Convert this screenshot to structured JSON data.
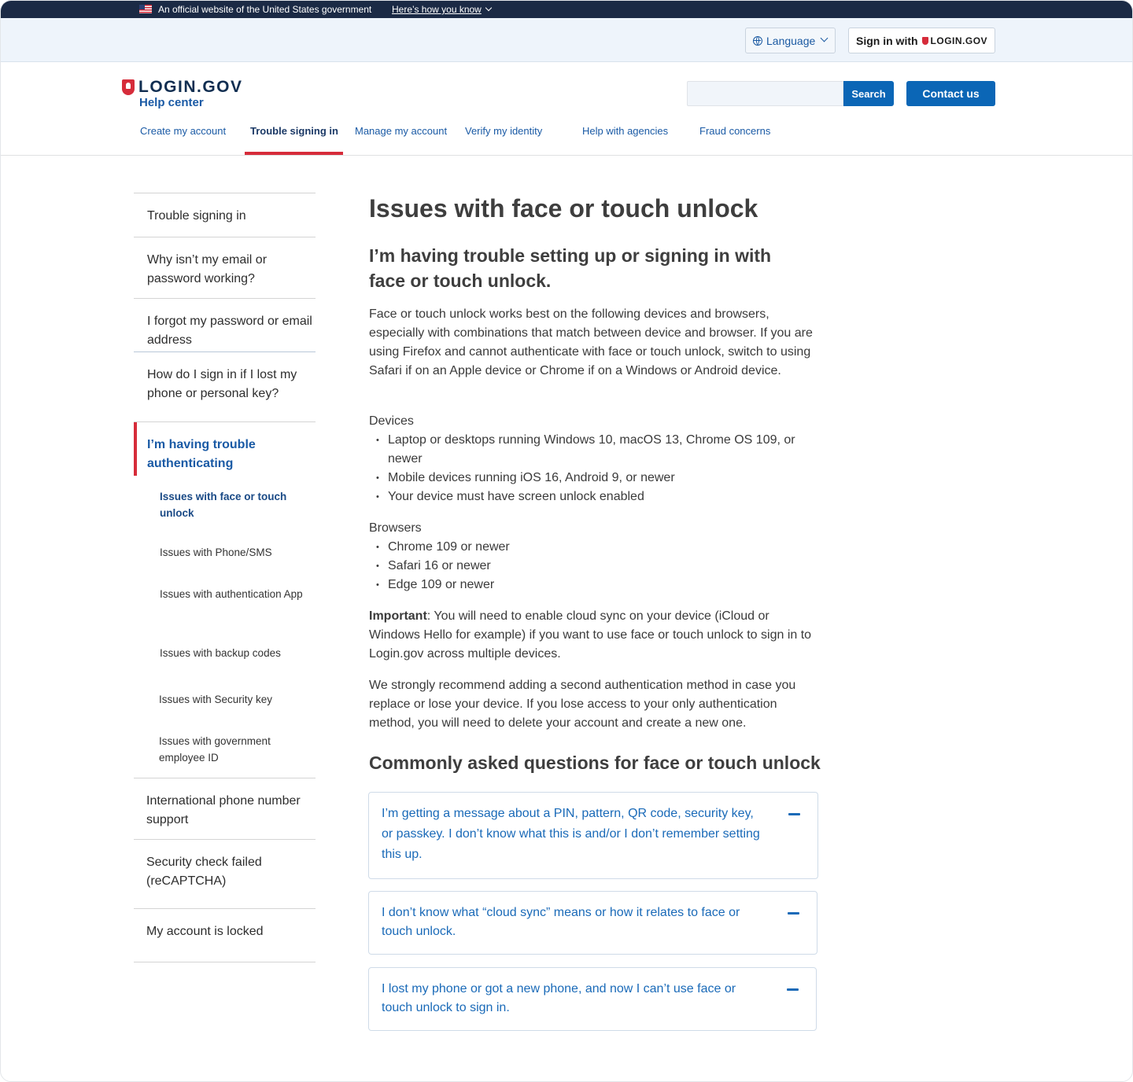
{
  "gov_banner": {
    "official_text": "An official website of the United States government",
    "how_link": "Here’s how you know"
  },
  "utility": {
    "language_label": "Language",
    "signin_label": "Sign in with",
    "signin_brand": "LOGIN.GOV"
  },
  "header": {
    "logo_text": "LOGIN.GOV",
    "subtitle": "Help center",
    "search_placeholder": "",
    "search_button": "Search",
    "contact_button": "Contact us",
    "nav": [
      {
        "label": "Create my account"
      },
      {
        "label": "Trouble signing in"
      },
      {
        "label": "Manage my account"
      },
      {
        "label": "Verify my identity"
      },
      {
        "label": "Help with agencies"
      },
      {
        "label": "Fraud concerns"
      }
    ]
  },
  "sidenav": {
    "items": [
      {
        "label": "Trouble signing in"
      },
      {
        "label": "Why isn’t my email or password working?"
      },
      {
        "label": "I forgot my password or email address"
      },
      {
        "label": "How do I sign in if I lost my phone or personal key?"
      },
      {
        "label": "I’m having trouble authenticating"
      },
      {
        "label": "International phone number support"
      },
      {
        "label": "Security check failed (reCAPTCHA)"
      },
      {
        "label": "My account is locked"
      }
    ],
    "subitems": [
      {
        "label": "Issues with face or touch unlock"
      },
      {
        "label": "Issues with Phone/SMS"
      },
      {
        "label": "Issues with authentication App"
      },
      {
        "label": "Issues with backup codes"
      },
      {
        "label": "Issues with Security key"
      },
      {
        "label": "Issues with government employee ID"
      }
    ]
  },
  "main": {
    "title": "Issues with face or touch unlock",
    "subtitle": "I’m having trouble setting up or signing in with face or touch unlock.",
    "intro": "Face or touch unlock works best on the following devices and browsers, especially with combinations that match between device and browser. If you are using Firefox and cannot authenticate with face or touch unlock, switch to using Safari if on an Apple device or Chrome if on a Windows or Android device.",
    "devices_label": "Devices",
    "devices": [
      "Laptop or desktops running Windows 10, macOS 13, Chrome OS 109, or newer",
      "Mobile devices running iOS 16, Android 9, or newer",
      "Your device must have screen unlock enabled"
    ],
    "browsers_label": "Browsers",
    "browsers": [
      "Chrome 109 or newer",
      "Safari 16 or newer",
      "Edge 109 or newer"
    ],
    "important_label": "Important",
    "important_text": ": You will need to enable cloud sync on your device (iCloud or Windows Hello for example) if you want to use face or touch unlock to sign in to Login.gov across multiple devices.",
    "recommend": "We strongly recommend adding a second authentication method in case you replace or lose your device. If you lose access to your only authentication method, you will need to delete your account and create a new one.",
    "faq_title": "Commonly asked questions for face or touch unlock",
    "faq": [
      {
        "question": "I’m getting a message about a PIN, pattern, QR code, security key, or passkey. I don’t know what this is and/or I don’t remember setting this up."
      },
      {
        "question": "I don’t know what “cloud sync” means or how it relates to face or touch unlock."
      },
      {
        "question": "I lost my phone or got a new phone, and now I can’t use face or touch unlock to sign in."
      }
    ]
  }
}
